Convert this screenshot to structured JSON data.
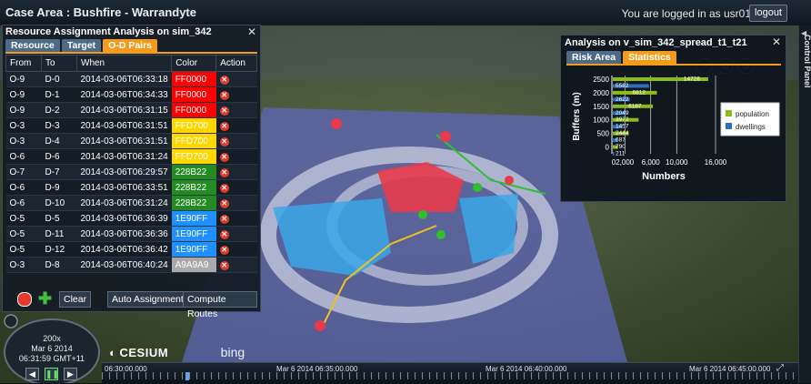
{
  "header": {
    "case_title": "Case Area : Bushfire - Warrandyte",
    "login_text": "You are logged in as usr01",
    "logout_label": "logout"
  },
  "control_panel": {
    "label": "Control Panel"
  },
  "resource_panel": {
    "title": "Resource Assignment Analysis on sim_342",
    "tabs": [
      {
        "label": "Resource",
        "active": false
      },
      {
        "label": "Target",
        "active": false
      },
      {
        "label": "O-D Pairs",
        "active": true
      }
    ],
    "columns": [
      "From",
      "To",
      "When",
      "Color",
      "Action"
    ],
    "rows": [
      {
        "from": "O-9",
        "to": "D-0",
        "when": "2014-03-06T06:33:18",
        "color": "FF0000"
      },
      {
        "from": "O-9",
        "to": "D-1",
        "when": "2014-03-06T06:34:33",
        "color": "FF0000"
      },
      {
        "from": "O-9",
        "to": "D-2",
        "when": "2014-03-06T06:31:15",
        "color": "FF0000"
      },
      {
        "from": "O-3",
        "to": "D-3",
        "when": "2014-03-06T06:31:51",
        "color": "FFD700"
      },
      {
        "from": "O-3",
        "to": "D-4",
        "when": "2014-03-06T06:31:51",
        "color": "FFD700"
      },
      {
        "from": "O-6",
        "to": "D-6",
        "when": "2014-03-06T06:31:24",
        "color": "FFD700"
      },
      {
        "from": "O-7",
        "to": "D-7",
        "when": "2014-03-06T06:29:57",
        "color": "228B22"
      },
      {
        "from": "O-6",
        "to": "D-9",
        "when": "2014-03-06T06:33:51",
        "color": "228B22"
      },
      {
        "from": "O-6",
        "to": "D-10",
        "when": "2014-03-06T06:31:24",
        "color": "228B22"
      },
      {
        "from": "O-5",
        "to": "D-5",
        "when": "2014-03-06T06:36:39",
        "color": "1E90FF"
      },
      {
        "from": "O-5",
        "to": "D-11",
        "when": "2014-03-06T06:36:36",
        "color": "1E90FF"
      },
      {
        "from": "O-5",
        "to": "D-12",
        "when": "2014-03-06T06:36:42",
        "color": "1E90FF"
      },
      {
        "from": "O-3",
        "to": "D-8",
        "when": "2014-03-06T06:40:24",
        "color": "A9A9A9"
      }
    ],
    "buttons": {
      "clear": "Clear",
      "auto_assignment": "Auto Assignment",
      "compute_routes": "Compute Routes"
    }
  },
  "analysis_panel": {
    "title": "Analysis on v_sim_342_spread_t1_t21",
    "tabs": [
      {
        "label": "Risk Area",
        "active": false
      },
      {
        "label": "Statistics",
        "active": true
      }
    ]
  },
  "chart_data": {
    "type": "bar",
    "orientation": "horizontal",
    "title": "",
    "xlabel": "Numbers",
    "ylabel": "Buffers (m)",
    "y_ticks": [
      "2500",
      "2000",
      "1500",
      "1000",
      "500",
      "0"
    ],
    "x_ticks": [
      "0",
      "2,000",
      "6,000",
      "10,000",
      "16,000"
    ],
    "xlim": [
      0,
      16000
    ],
    "legend_position": "right",
    "series": [
      {
        "name": "population",
        "color": "#8bbd1a",
        "points": [
          {
            "buffer": 2500,
            "value": 14726
          },
          {
            "buffer": 2000,
            "value": 6812
          },
          {
            "buffer": 1500,
            "value": 6187
          },
          {
            "buffer": 1000,
            "value": 3972
          },
          {
            "buffer": 500,
            "value": 2444
          },
          {
            "buffer": 0,
            "value": 790
          }
        ]
      },
      {
        "name": "dwellings",
        "color": "#2a6fc0",
        "points": [
          {
            "buffer": 2250,
            "value": 5582
          },
          {
            "buffer": 1750,
            "value": 2622
          },
          {
            "buffer": 1250,
            "value": 2049
          },
          {
            "buffer": 750,
            "value": 1457
          },
          {
            "buffer": 250,
            "value": 687
          },
          {
            "buffer": -250,
            "value": 211
          }
        ]
      }
    ]
  },
  "timeline": {
    "labels": [
      "06:30:00.000",
      "Mar 6 2014 06:35:00.000",
      "Mar 6 2014 06:40:00.000",
      "Mar 6 2014 06:45:00.000"
    ]
  },
  "clock": {
    "speed": "200x",
    "date": "Mar 6 2014",
    "time": "06:31:59 GMT+11"
  },
  "logos": {
    "cesium": "CESIUM",
    "bing": "bing"
  }
}
